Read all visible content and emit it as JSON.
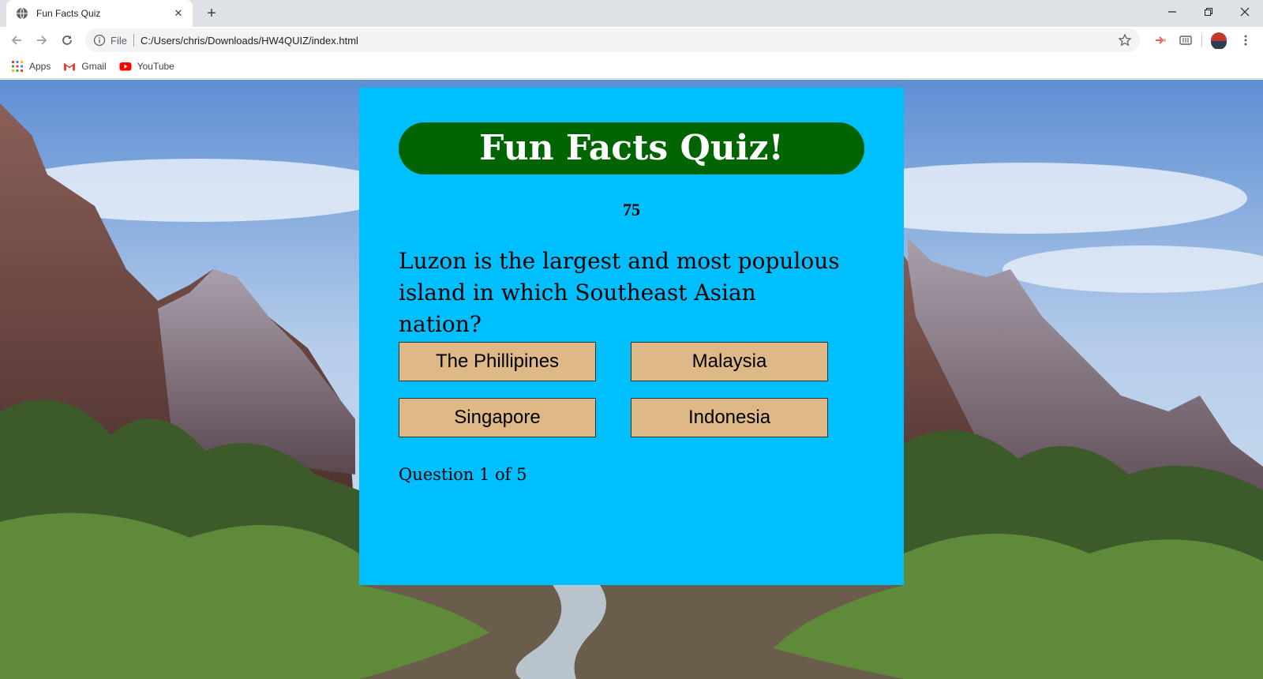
{
  "browser": {
    "tab_title": "Fun Facts Quiz",
    "scheme_label": "File",
    "url": "C:/Users/chris/Downloads/HW4QUIZ/index.html",
    "bookmarks": [
      {
        "label": "Apps",
        "icon": "apps-grid-icon"
      },
      {
        "label": "Gmail",
        "icon": "gmail-icon"
      },
      {
        "label": "YouTube",
        "icon": "youtube-icon"
      }
    ],
    "window_controls": [
      "minimize",
      "restore",
      "close"
    ]
  },
  "quiz": {
    "title": "Fun Facts Quiz!",
    "timer": "75",
    "question": "Luzon is the largest and most populous island in which Southeast Asian nation?",
    "answers": [
      "The Phillipines",
      "Malaysia",
      "Singapore",
      "Indonesia"
    ],
    "progress": "Question 1 of 5"
  },
  "colors": {
    "card_bg": "#00bfff",
    "title_bg": "#006400",
    "answer_bg": "#deb887",
    "tabstrip_bg": "#dee1e6",
    "omnibox_bg": "#f1f3f4"
  }
}
